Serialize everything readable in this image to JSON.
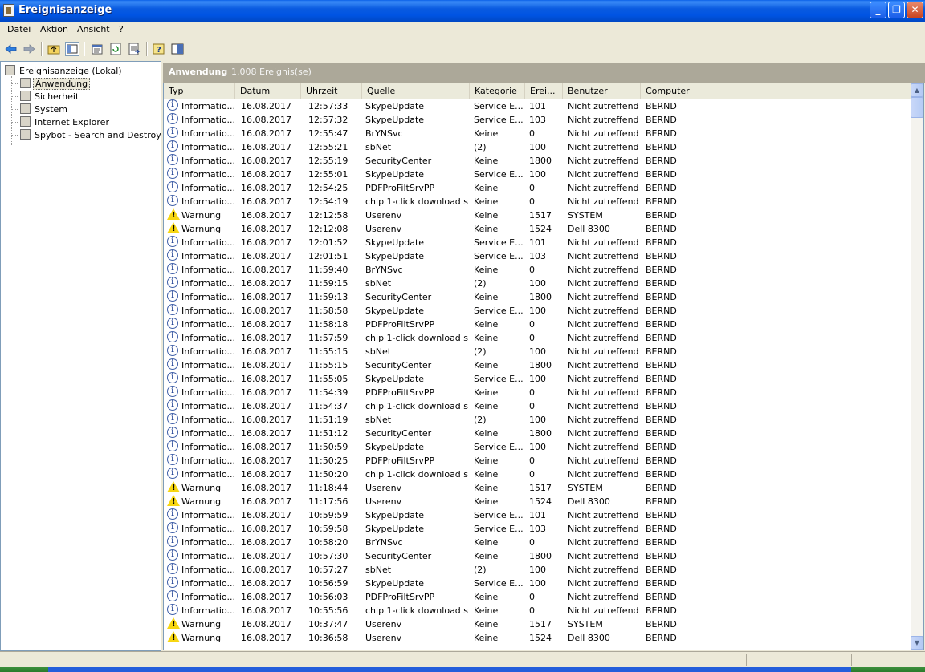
{
  "window": {
    "title": "Ereignisanzeige",
    "min": "_",
    "max": "❐",
    "close": "✕"
  },
  "menu": [
    "Datei",
    "Aktion",
    "Ansicht",
    "?"
  ],
  "tree": {
    "root": "Ereignisanzeige (Lokal)",
    "items": [
      "Anwendung",
      "Sicherheit",
      "System",
      "Internet Explorer",
      "Spybot - Search and Destroy"
    ],
    "selected": "Anwendung"
  },
  "pane": {
    "name": "Anwendung",
    "count": "1.008 Ereignis(se)"
  },
  "columns": [
    "Typ",
    "Datum",
    "Uhrzeit",
    "Quelle",
    "Kategorie",
    "Erei...",
    "Benutzer",
    "Computer"
  ],
  "rows": [
    [
      "info",
      "Informatio...",
      "16.08.2017",
      "12:57:33",
      "SkypeUpdate",
      "Service E...",
      "101",
      "Nicht zutreffend",
      "BERND"
    ],
    [
      "info",
      "Informatio...",
      "16.08.2017",
      "12:57:32",
      "SkypeUpdate",
      "Service E...",
      "103",
      "Nicht zutreffend",
      "BERND"
    ],
    [
      "info",
      "Informatio...",
      "16.08.2017",
      "12:55:47",
      "BrYNSvc",
      "Keine",
      "0",
      "Nicht zutreffend",
      "BERND"
    ],
    [
      "info",
      "Informatio...",
      "16.08.2017",
      "12:55:21",
      "sbNet",
      "(2)",
      "100",
      "Nicht zutreffend",
      "BERND"
    ],
    [
      "info",
      "Informatio...",
      "16.08.2017",
      "12:55:19",
      "SecurityCenter",
      "Keine",
      "1800",
      "Nicht zutreffend",
      "BERND"
    ],
    [
      "info",
      "Informatio...",
      "16.08.2017",
      "12:55:01",
      "SkypeUpdate",
      "Service E...",
      "100",
      "Nicht zutreffend",
      "BERND"
    ],
    [
      "info",
      "Informatio...",
      "16.08.2017",
      "12:54:25",
      "PDFProFiltSrvPP",
      "Keine",
      "0",
      "Nicht zutreffend",
      "BERND"
    ],
    [
      "info",
      "Informatio...",
      "16.08.2017",
      "12:54:19",
      "chip 1-click download s...",
      "Keine",
      "0",
      "Nicht zutreffend",
      "BERND"
    ],
    [
      "warn",
      "Warnung",
      "16.08.2017",
      "12:12:58",
      "Userenv",
      "Keine",
      "1517",
      "SYSTEM",
      "BERND"
    ],
    [
      "warn",
      "Warnung",
      "16.08.2017",
      "12:12:08",
      "Userenv",
      "Keine",
      "1524",
      "Dell 8300",
      "BERND"
    ],
    [
      "info",
      "Informatio...",
      "16.08.2017",
      "12:01:52",
      "SkypeUpdate",
      "Service E...",
      "101",
      "Nicht zutreffend",
      "BERND"
    ],
    [
      "info",
      "Informatio...",
      "16.08.2017",
      "12:01:51",
      "SkypeUpdate",
      "Service E...",
      "103",
      "Nicht zutreffend",
      "BERND"
    ],
    [
      "info",
      "Informatio...",
      "16.08.2017",
      "11:59:40",
      "BrYNSvc",
      "Keine",
      "0",
      "Nicht zutreffend",
      "BERND"
    ],
    [
      "info",
      "Informatio...",
      "16.08.2017",
      "11:59:15",
      "sbNet",
      "(2)",
      "100",
      "Nicht zutreffend",
      "BERND"
    ],
    [
      "info",
      "Informatio...",
      "16.08.2017",
      "11:59:13",
      "SecurityCenter",
      "Keine",
      "1800",
      "Nicht zutreffend",
      "BERND"
    ],
    [
      "info",
      "Informatio...",
      "16.08.2017",
      "11:58:58",
      "SkypeUpdate",
      "Service E...",
      "100",
      "Nicht zutreffend",
      "BERND"
    ],
    [
      "info",
      "Informatio...",
      "16.08.2017",
      "11:58:18",
      "PDFProFiltSrvPP",
      "Keine",
      "0",
      "Nicht zutreffend",
      "BERND"
    ],
    [
      "info",
      "Informatio...",
      "16.08.2017",
      "11:57:59",
      "chip 1-click download s...",
      "Keine",
      "0",
      "Nicht zutreffend",
      "BERND"
    ],
    [
      "info",
      "Informatio...",
      "16.08.2017",
      "11:55:15",
      "sbNet",
      "(2)",
      "100",
      "Nicht zutreffend",
      "BERND"
    ],
    [
      "info",
      "Informatio...",
      "16.08.2017",
      "11:55:15",
      "SecurityCenter",
      "Keine",
      "1800",
      "Nicht zutreffend",
      "BERND"
    ],
    [
      "info",
      "Informatio...",
      "16.08.2017",
      "11:55:05",
      "SkypeUpdate",
      "Service E...",
      "100",
      "Nicht zutreffend",
      "BERND"
    ],
    [
      "info",
      "Informatio...",
      "16.08.2017",
      "11:54:39",
      "PDFProFiltSrvPP",
      "Keine",
      "0",
      "Nicht zutreffend",
      "BERND"
    ],
    [
      "info",
      "Informatio...",
      "16.08.2017",
      "11:54:37",
      "chip 1-click download s...",
      "Keine",
      "0",
      "Nicht zutreffend",
      "BERND"
    ],
    [
      "info",
      "Informatio...",
      "16.08.2017",
      "11:51:19",
      "sbNet",
      "(2)",
      "100",
      "Nicht zutreffend",
      "BERND"
    ],
    [
      "info",
      "Informatio...",
      "16.08.2017",
      "11:51:12",
      "SecurityCenter",
      "Keine",
      "1800",
      "Nicht zutreffend",
      "BERND"
    ],
    [
      "info",
      "Informatio...",
      "16.08.2017",
      "11:50:59",
      "SkypeUpdate",
      "Service E...",
      "100",
      "Nicht zutreffend",
      "BERND"
    ],
    [
      "info",
      "Informatio...",
      "16.08.2017",
      "11:50:25",
      "PDFProFiltSrvPP",
      "Keine",
      "0",
      "Nicht zutreffend",
      "BERND"
    ],
    [
      "info",
      "Informatio...",
      "16.08.2017",
      "11:50:20",
      "chip 1-click download s...",
      "Keine",
      "0",
      "Nicht zutreffend",
      "BERND"
    ],
    [
      "warn",
      "Warnung",
      "16.08.2017",
      "11:18:44",
      "Userenv",
      "Keine",
      "1517",
      "SYSTEM",
      "BERND"
    ],
    [
      "warn",
      "Warnung",
      "16.08.2017",
      "11:17:56",
      "Userenv",
      "Keine",
      "1524",
      "Dell 8300",
      "BERND"
    ],
    [
      "info",
      "Informatio...",
      "16.08.2017",
      "10:59:59",
      "SkypeUpdate",
      "Service E...",
      "101",
      "Nicht zutreffend",
      "BERND"
    ],
    [
      "info",
      "Informatio...",
      "16.08.2017",
      "10:59:58",
      "SkypeUpdate",
      "Service E...",
      "103",
      "Nicht zutreffend",
      "BERND"
    ],
    [
      "info",
      "Informatio...",
      "16.08.2017",
      "10:58:20",
      "BrYNSvc",
      "Keine",
      "0",
      "Nicht zutreffend",
      "BERND"
    ],
    [
      "info",
      "Informatio...",
      "16.08.2017",
      "10:57:30",
      "SecurityCenter",
      "Keine",
      "1800",
      "Nicht zutreffend",
      "BERND"
    ],
    [
      "info",
      "Informatio...",
      "16.08.2017",
      "10:57:27",
      "sbNet",
      "(2)",
      "100",
      "Nicht zutreffend",
      "BERND"
    ],
    [
      "info",
      "Informatio...",
      "16.08.2017",
      "10:56:59",
      "SkypeUpdate",
      "Service E...",
      "100",
      "Nicht zutreffend",
      "BERND"
    ],
    [
      "info",
      "Informatio...",
      "16.08.2017",
      "10:56:03",
      "PDFProFiltSrvPP",
      "Keine",
      "0",
      "Nicht zutreffend",
      "BERND"
    ],
    [
      "info",
      "Informatio...",
      "16.08.2017",
      "10:55:56",
      "chip 1-click download s...",
      "Keine",
      "0",
      "Nicht zutreffend",
      "BERND"
    ],
    [
      "warn",
      "Warnung",
      "16.08.2017",
      "10:37:47",
      "Userenv",
      "Keine",
      "1517",
      "SYSTEM",
      "BERND"
    ],
    [
      "warn",
      "Warnung",
      "16.08.2017",
      "10:36:58",
      "Userenv",
      "Keine",
      "1524",
      "Dell 8300",
      "BERND"
    ]
  ]
}
